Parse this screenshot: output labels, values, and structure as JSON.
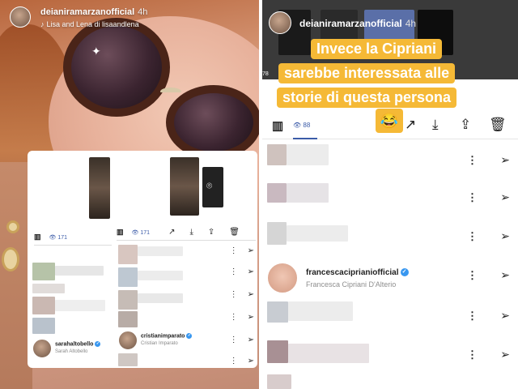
{
  "left_story": {
    "username": "deianiramarzanofficial",
    "time": "4h",
    "music": "Lisa and Lena di lisaandlena",
    "stats": {
      "views_a": "171",
      "views_b": "171"
    },
    "profiles": [
      {
        "username": "sarahaltobello",
        "full_name": "Sarah Altobello"
      },
      {
        "username": "cristianimparato",
        "full_name": "Cristian Imparato"
      }
    ]
  },
  "right_story": {
    "username": "deianiramarzanofficial",
    "time": "4h",
    "side_count": "78",
    "caption_lines": [
      "Invece la Cipriani",
      "sarebbe interessata alle",
      "storie di questa persona"
    ],
    "emoji": "😂",
    "views": "88",
    "profile": {
      "username": "francescaciprianiofficial",
      "full_name": "Francesca Cipriani D'Alterio"
    }
  },
  "icons": {
    "bars": "bar-chart-icon",
    "eye": "eye-icon",
    "share": "arrow-icon",
    "download": "download-icon",
    "upload": "upload-icon",
    "trash": "trash-icon",
    "more": "more-icon",
    "send": "send-icon"
  },
  "colors": {
    "caption_bg": "#f5b936",
    "accent": "#3b5ba8",
    "verified": "#3897f0"
  }
}
